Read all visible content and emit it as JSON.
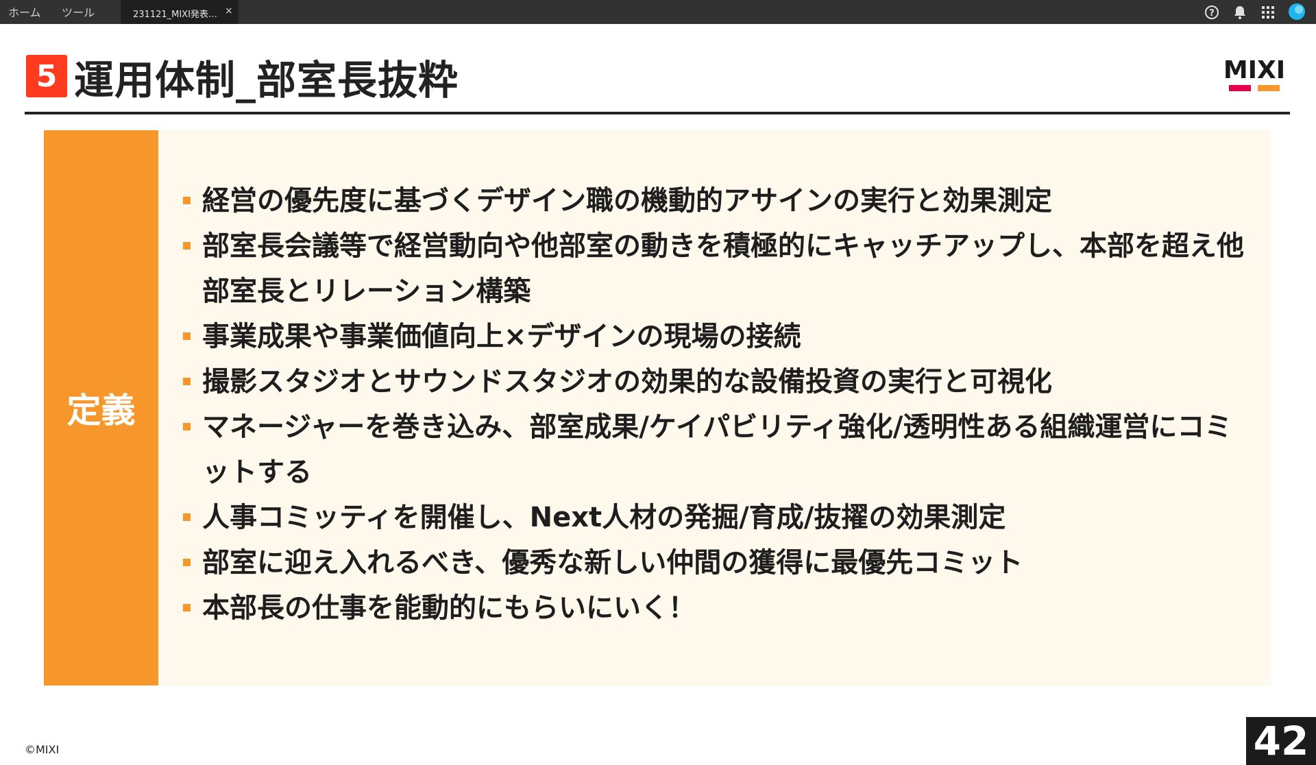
{
  "app": {
    "nav": [
      "ホーム",
      "ツール"
    ],
    "tab": {
      "label": "231121_MIXI発表…",
      "close": "×"
    },
    "icons": [
      "help-icon",
      "bell-icon",
      "apps-grid-icon",
      "avatar"
    ]
  },
  "slide": {
    "section_number": "5",
    "title": "運用体制_部室長抜粋",
    "logo_text": "MIXI",
    "side_label": "定義",
    "bullets": [
      "経営の優先度に基づくデザイン職の機動的アサインの実行と効果測定",
      "部室長会議等で経営動向や他部室の動きを積極的にキャッチアップし、本部を超え他部室長とリレーション構築",
      "事業成果や事業価値向上×デザインの現場の接続",
      "撮影スタジオとサウンドスタジオの効果的な設備投資の実行と可視化",
      "マネージャーを巻き込み、部室成果/ケイパビリティ強化/透明性ある組織運営にコミットする",
      "人事コミッティを開催し、Next人材の発掘/育成/抜擢の効果測定",
      "部室に迎え入れるべき、優秀な新しい仲間の獲得に最優先コミット",
      "本部長の仕事を能動的にもらいにいく！"
    ],
    "copyright": "©MIXI",
    "page_number": "42",
    "colors": {
      "accent_orange": "#f7962b",
      "badge_red": "#ff3b1f",
      "content_bg": "#fff8ec",
      "logo_pink": "#e6004b"
    }
  }
}
